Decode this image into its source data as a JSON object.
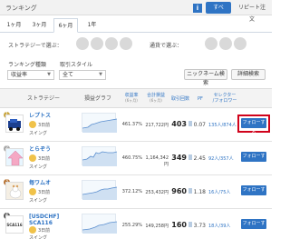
{
  "header": {
    "title": "ランキング",
    "info_icon": "i",
    "tab_all": "すべて",
    "tab_repeat": "リピート注文"
  },
  "period_tabs": [
    "1ヶ月",
    "3ヶ月",
    "6ヶ月",
    "1年"
  ],
  "filters": {
    "strategy_select_label": "ストラテジーで選ぶ：",
    "pair_select_label": "通貨で選ぶ：",
    "ranking_type_label": "ランキング種類",
    "trade_style_label": "取引スタイル",
    "ranking_type_value": "収益率",
    "trade_style_value": "全て",
    "nickname_search": "ニックネーム検索",
    "detail_search": "詳細検索"
  },
  "table": {
    "headers": {
      "strategy": "ストラテジー",
      "graph": "損益グラフ",
      "return_rate": "収益率",
      "return_sub": "(6ヶ月)",
      "total_profit": "合計損益",
      "total_profit_sub": "(6ヶ月)",
      "trade_count": "取引回数",
      "pf": "PF",
      "selector": "セレクター",
      "follower": "/フォロワー"
    },
    "rows": [
      {
        "rank": "1",
        "name": "レプトス",
        "user": "3日前",
        "style": "スイング",
        "return_rate": "461.37%",
        "total_profit": "217,722円",
        "trade_count": "403",
        "pf": "0.07",
        "selector": "135人/874人",
        "follow": "フォローする",
        "thumb": "blue-car"
      },
      {
        "rank": "2",
        "name": "とらぞう",
        "user": "3日前",
        "style": "スイング",
        "return_rate": "460.75%",
        "total_profit": "1,164,342円",
        "trade_count": "349",
        "pf": "2.45",
        "selector": "92人/357人",
        "follow": "フォローする",
        "thumb": "pink-arrow"
      },
      {
        "rank": "3",
        "name": "毎ワムオ",
        "user": "3日前",
        "style": "スイング",
        "return_rate": "372.12%",
        "total_profit": "253,432円",
        "trade_count": "960",
        "pf": "1.18",
        "selector": "16人/75人",
        "follow": "フォローする",
        "thumb": "animal"
      },
      {
        "rank": "4",
        "name": "[USDCHF] SCA116",
        "user": "3日前",
        "style": "スイング",
        "return_rate": "255.29%",
        "total_profit": "149,258円",
        "trade_count": "160",
        "pf": "3.73",
        "selector": "18人/39人",
        "follow": "フォローする",
        "thumb": "sca-text",
        "thumb_text": "SCA116"
      }
    ]
  },
  "colors": {
    "accent": "#2f74c4",
    "highlight": "#d0021b",
    "gold": "#c9a640"
  }
}
